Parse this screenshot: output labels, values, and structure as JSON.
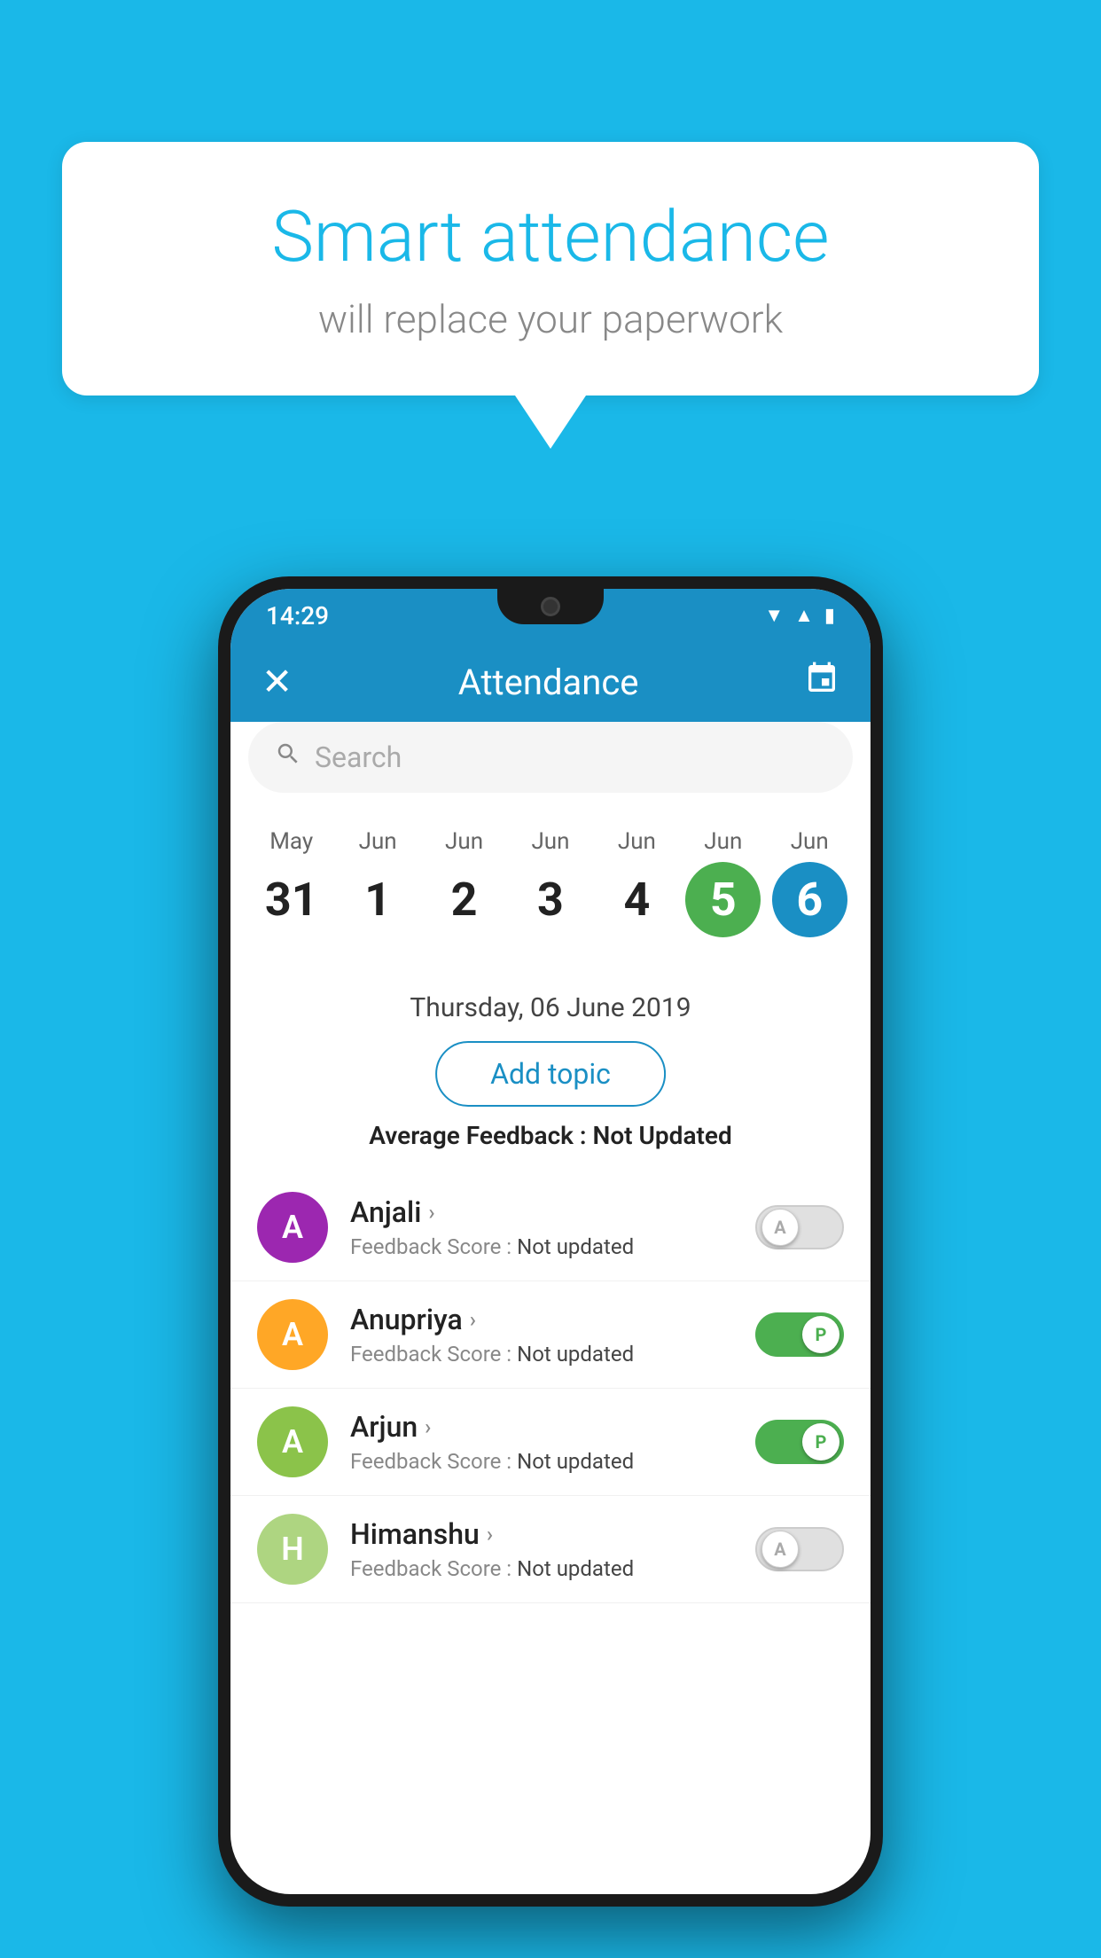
{
  "background": {
    "color": "#1ab8e8"
  },
  "speech_bubble": {
    "title": "Smart attendance",
    "subtitle": "will replace your paperwork"
  },
  "phone": {
    "status_bar": {
      "time": "14:29",
      "wifi": "▼",
      "signal": "▲",
      "battery": "▮"
    },
    "app_bar": {
      "close_label": "✕",
      "title": "Attendance",
      "calendar_icon": "📅"
    },
    "search": {
      "placeholder": "Search"
    },
    "calendar": {
      "days": [
        {
          "month": "May",
          "date": "31",
          "state": "normal"
        },
        {
          "month": "Jun",
          "date": "1",
          "state": "normal"
        },
        {
          "month": "Jun",
          "date": "2",
          "state": "normal"
        },
        {
          "month": "Jun",
          "date": "3",
          "state": "normal"
        },
        {
          "month": "Jun",
          "date": "4",
          "state": "normal"
        },
        {
          "month": "Jun",
          "date": "5",
          "state": "today"
        },
        {
          "month": "Jun",
          "date": "6",
          "state": "selected"
        }
      ]
    },
    "selected_date_label": "Thursday, 06 June 2019",
    "add_topic_btn": "Add topic",
    "avg_feedback_label": "Average Feedback : ",
    "avg_feedback_value": "Not Updated",
    "students": [
      {
        "name": "Anjali",
        "avatar_letter": "A",
        "avatar_color": "#9c27b0",
        "feedback_label": "Feedback Score : ",
        "feedback_value": "Not updated",
        "toggle_state": "off",
        "toggle_letter": "A"
      },
      {
        "name": "Anupriya",
        "avatar_letter": "A",
        "avatar_color": "#ffa726",
        "feedback_label": "Feedback Score : ",
        "feedback_value": "Not updated",
        "toggle_state": "on",
        "toggle_letter": "P"
      },
      {
        "name": "Arjun",
        "avatar_letter": "A",
        "avatar_color": "#8bc34a",
        "feedback_label": "Feedback Score : ",
        "feedback_value": "Not updated",
        "toggle_state": "on",
        "toggle_letter": "P"
      },
      {
        "name": "Himanshu",
        "avatar_letter": "H",
        "avatar_color": "#aed581",
        "feedback_label": "Feedback Score : ",
        "feedback_value": "Not updated",
        "toggle_state": "off",
        "toggle_letter": "A"
      }
    ]
  }
}
